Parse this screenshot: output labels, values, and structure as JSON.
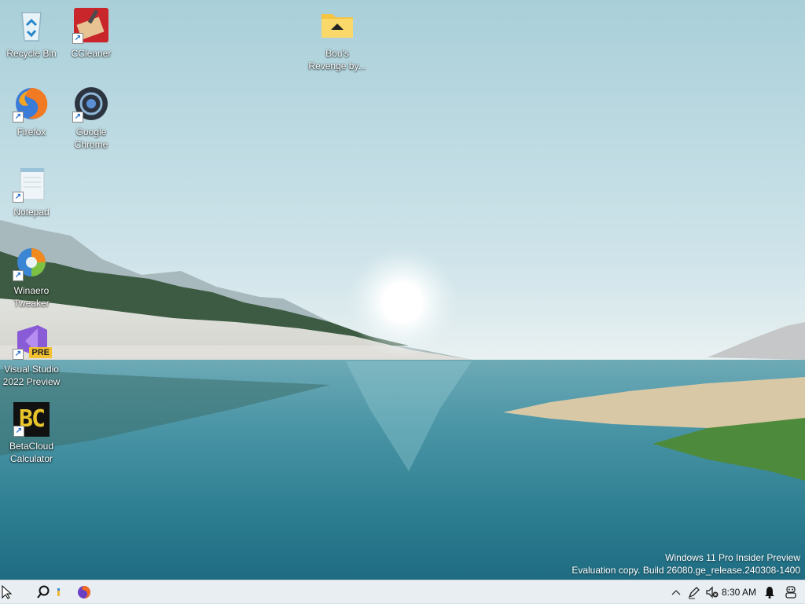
{
  "desktop": {
    "icons": [
      {
        "label": "Recycle Bin",
        "icon": "recycle-bin-icon",
        "shortcut": false
      },
      {
        "label": "CCleaner",
        "icon": "ccleaner-icon",
        "shortcut": true
      },
      {
        "label": "Bou's Revenge by...",
        "icon": "folder-icon",
        "shortcut": false
      },
      {
        "label": "Firefox",
        "icon": "firefox-icon",
        "shortcut": true
      },
      {
        "label": "Google Chrome",
        "icon": "chrome-icon",
        "shortcut": true
      },
      {
        "label": "Notepad",
        "icon": "notepad-icon",
        "shortcut": true
      },
      {
        "label": "Winaero Tweaker",
        "icon": "winaero-tweaker-icon",
        "shortcut": true
      },
      {
        "label": "Visual Studio 2022 Preview",
        "icon": "visual-studio-icon",
        "shortcut": true,
        "badge": "PRE"
      },
      {
        "label": "BetaCloud Calculator",
        "icon": "betacloud-calculator-icon",
        "shortcut": true,
        "glyph_text": "BC"
      }
    ]
  },
  "watermark": {
    "line1": "Windows 11 Pro Insider Preview",
    "line2": "Evaluation copy. Build 26080.ge_release.240308-1400"
  },
  "taskbar": {
    "items": [
      "start-icon",
      "search-icon",
      "file-explorer-icon",
      "firefox-icon"
    ],
    "tray": [
      "chevron-up-icon",
      "pen-icon",
      "volume-muted-icon"
    ],
    "clock": "8:30 AM",
    "notification_icon": "bell-icon",
    "copilot_icon": "copilot-icon"
  },
  "colors": {
    "sky": "#bcd9e2",
    "water": "#2f8191",
    "taskbar": "#e8eef2"
  }
}
